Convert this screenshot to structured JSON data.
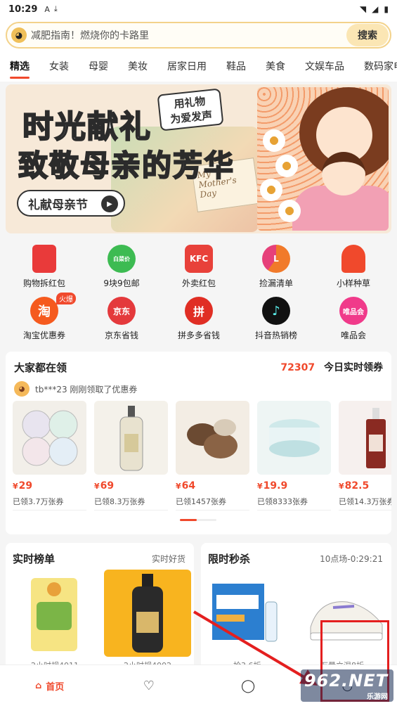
{
  "status_bar": {
    "time": "10:29"
  },
  "search": {
    "placeholder": "减肥指南！燃烧你的卡路里",
    "button": "搜索"
  },
  "tabs": [
    {
      "label": "精选",
      "active": true
    },
    {
      "label": "女装"
    },
    {
      "label": "母婴"
    },
    {
      "label": "美妆"
    },
    {
      "label": "居家日用"
    },
    {
      "label": "鞋品"
    },
    {
      "label": "美食"
    },
    {
      "label": "文娱车品"
    },
    {
      "label": "数码家电"
    }
  ],
  "banner": {
    "title_line1": "时光献礼",
    "title_line2": "致敬母亲的芳华",
    "tag_line1": "用礼物",
    "tag_line2": "为爱发声",
    "cta": "礼献母亲节",
    "card_text": "My Mother's Day"
  },
  "shortcuts": [
    {
      "label": "购物拆红包",
      "icon": "red-envelope-icon",
      "color": "#e93a3a",
      "glyph": ""
    },
    {
      "label": "9块9包邮",
      "icon": "umbrella-icon",
      "color": "#3dbb52",
      "glyph": "白菜价"
    },
    {
      "label": "外卖红包",
      "icon": "kfc-icon",
      "color": "#e8413a",
      "glyph": "KFC"
    },
    {
      "label": "捡漏清单",
      "icon": "pie-icon",
      "color": "#f17a2a",
      "glyph": "L"
    },
    {
      "label": "小样种草",
      "icon": "mushroom-icon",
      "color": "#f0492c",
      "glyph": ""
    },
    {
      "label": "淘宝优惠券",
      "icon": "taobao-icon",
      "color": "#f55a1e",
      "glyph": "淘",
      "badge": "火爆"
    },
    {
      "label": "京东省钱",
      "icon": "jd-icon",
      "color": "#e4393c",
      "glyph": "京东"
    },
    {
      "label": "拼多多省钱",
      "icon": "pdd-icon",
      "color": "#e02e24",
      "glyph": "拼"
    },
    {
      "label": "抖音热销榜",
      "icon": "douyin-icon",
      "color": "#111111",
      "glyph": "♪"
    },
    {
      "label": "唯品会",
      "icon": "vip-icon",
      "color": "#f03a8a",
      "glyph": "唯品会"
    }
  ],
  "coupons": {
    "title": "大家都在领",
    "count": "72307",
    "count_label": "今日实时领券",
    "ticker": "tb***23 刚刚领取了优惠券",
    "products": [
      {
        "price": "29",
        "claimed": "已领3.7万张券",
        "bg": "#f2efe9",
        "label": "matti"
      },
      {
        "price": "69",
        "claimed": "已领8.3万张券",
        "bg": "#f4f1ea",
        "label": "Roos"
      },
      {
        "price": "64",
        "claimed": "已领1457张券",
        "bg": "#f3ede4",
        "label": "Mamonde"
      },
      {
        "price": "19.9",
        "claimed": "已领8333张券",
        "bg": "#eef5f4",
        "label": "cream"
      },
      {
        "price": "82.5",
        "claimed": "已领14.3万张券",
        "bg": "#f6f0ee",
        "label": "serum"
      }
    ]
  },
  "ranking": {
    "title": "实时榜单",
    "subtitle": "实时好货",
    "cap1": "2小时规4011",
    "cap2": "2小时规4002"
  },
  "flash": {
    "title": "限时秒杀",
    "subtitle": "10点场-0:29:21",
    "cap1": "抢3.6折",
    "cap2": "万量立混8折"
  },
  "nav": [
    {
      "label": "首页",
      "icon": "home-icon",
      "active": true
    },
    {
      "label": "",
      "icon": "heart-icon"
    },
    {
      "label": "",
      "icon": "search-icon"
    },
    {
      "label": "",
      "icon": "profile-icon"
    }
  ],
  "watermark": {
    "line1": "962.NET",
    "line2": "乐游网"
  }
}
